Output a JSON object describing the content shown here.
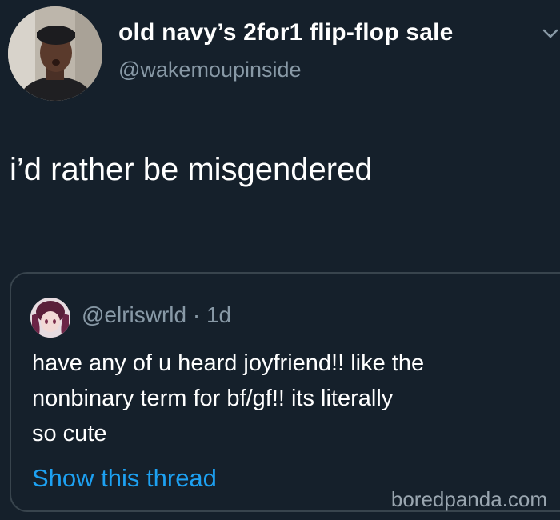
{
  "tweet": {
    "display_name": "old navy’s 2for1 flip-flop sale",
    "handle": "@wakemoupinside",
    "text": "i’d rather be misgendered",
    "avatar_icon": "user-avatar-icon",
    "menu_icon": "chevron-down-icon"
  },
  "quoted_tweet": {
    "handle_line": "@elriswrld · 1d",
    "text_lines": [
      "have any of u heard joyfriend!! like the",
      "nonbinary term for bf/gf!! its literally",
      "so cute"
    ],
    "show_thread_label": "Show this thread",
    "avatar_icon": "quoted-user-avatar-icon"
  },
  "watermark": "boredpanda.com",
  "colors": {
    "background": "#15202b",
    "secondary_text": "#8899a6",
    "link": "#1da1f2",
    "border": "#38444d"
  }
}
